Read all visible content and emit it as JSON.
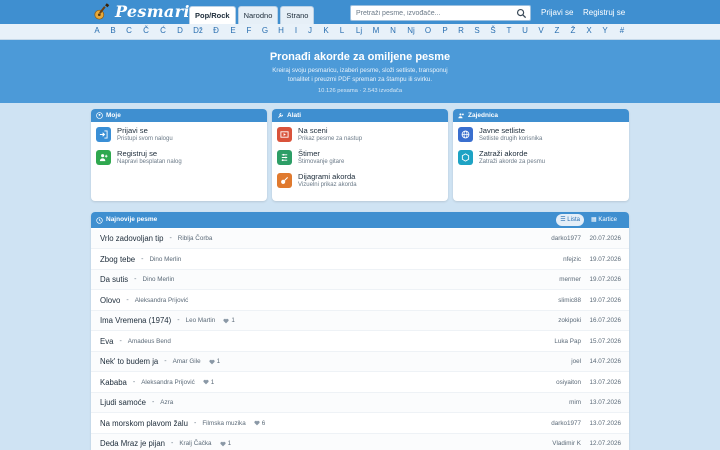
{
  "header": {
    "logo_text": "Pesmarica",
    "tabs": [
      {
        "label": "Pop/Rock",
        "active": true
      },
      {
        "label": "Narodno",
        "active": false
      },
      {
        "label": "Strano",
        "active": false
      }
    ],
    "search_placeholder": "Pretraži pesme, izvođače...",
    "login_label": "Prijavi se",
    "register_label": "Registruj se"
  },
  "alphabet": [
    "A",
    "B",
    "C",
    "Č",
    "Ć",
    "D",
    "Dž",
    "Đ",
    "E",
    "F",
    "G",
    "H",
    "I",
    "J",
    "K",
    "L",
    "Lj",
    "M",
    "N",
    "Nj",
    "O",
    "P",
    "R",
    "S",
    "Š",
    "T",
    "U",
    "V",
    "Z",
    "Ž",
    "X",
    "Y",
    "#"
  ],
  "hero": {
    "title": "Pronađi akorde za omiljene pesme",
    "subtitle": "Kreiraj svoju pesmaricu, izaberi pesme, složi setliste, transponuj tonalitet i preuzmi PDF spreman za štampu ili svirku.",
    "stats": "10.126 pesama · 2.543 izvođača"
  },
  "cards": {
    "moje": {
      "title": "Moje",
      "items": [
        {
          "title": "Prijavi se",
          "desc": "Pristupi svom nalogu",
          "icon": "login-icon",
          "color": "#3a8fd6"
        },
        {
          "title": "Registruj se",
          "desc": "Napravi besplatan nalog",
          "icon": "add-user-icon",
          "color": "#2fa84f"
        }
      ]
    },
    "alati": {
      "title": "Alati",
      "items": [
        {
          "title": "Na sceni",
          "desc": "Prikaz pesme za nastup",
          "icon": "stage-icon",
          "color": "#d9533b"
        },
        {
          "title": "Štimer",
          "desc": "Štimovanje gitare",
          "icon": "tuner-icon",
          "color": "#2d9e66"
        },
        {
          "title": "Dijagrami akorda",
          "desc": "Vizuelni prikaz akorda",
          "icon": "guitar-icon",
          "color": "#e07a2f"
        }
      ]
    },
    "zajednica": {
      "title": "Zajednica",
      "items": [
        {
          "title": "Javne setliste",
          "desc": "Setliste drugih korisnika",
          "icon": "globe-icon",
          "color": "#3a6fcf"
        },
        {
          "title": "Zatraži akorde",
          "desc": "Zatraži akorde za pesmu",
          "icon": "request-icon",
          "color": "#1ea3c4"
        }
      ]
    }
  },
  "songs": {
    "title": "Najnovije pesme",
    "view_list": "Lista",
    "view_cards": "Kartice",
    "rows": [
      {
        "title": "Vrlo zadovoljan tip",
        "artist": "Riblja Čorba",
        "likes": "",
        "user": "darko1977",
        "date": "20.07.2026"
      },
      {
        "title": "Zbog tebe",
        "artist": "Dino Merlin",
        "likes": "",
        "user": "nfejzic",
        "date": "19.07.2026"
      },
      {
        "title": "Da sutis",
        "artist": "Dino Merlin",
        "likes": "",
        "user": "mermer",
        "date": "19.07.2026"
      },
      {
        "title": "Olovo",
        "artist": "Aleksandra Prijović",
        "likes": "",
        "user": "slimic88",
        "date": "19.07.2026"
      },
      {
        "title": "Ima Vremena (1974)",
        "artist": "Leo Martin",
        "likes": "1",
        "user": "zokipoki",
        "date": "16.07.2026"
      },
      {
        "title": "Eva",
        "artist": "Amadeus Bend",
        "likes": "",
        "user": "Luka Pap",
        "date": "15.07.2026"
      },
      {
        "title": "Nek' to budem ja",
        "artist": "Amar Gile",
        "likes": "1",
        "user": "joel",
        "date": "14.07.2026"
      },
      {
        "title": "Kababa",
        "artist": "Aleksandra Prijović",
        "likes": "1",
        "user": "osiyaiton",
        "date": "13.07.2026"
      },
      {
        "title": "Ljudi samoće",
        "artist": "Azra",
        "likes": "",
        "user": "mim",
        "date": "13.07.2026"
      },
      {
        "title": "Na morskom plavom žalu",
        "artist": "Filmska muzika",
        "likes": "6",
        "user": "darko1977",
        "date": "13.07.2026"
      },
      {
        "title": "Deda Mraz je pijan",
        "artist": "Kralj Čačka",
        "likes": "1",
        "user": "Vladimir K",
        "date": "12.07.2026"
      }
    ]
  }
}
